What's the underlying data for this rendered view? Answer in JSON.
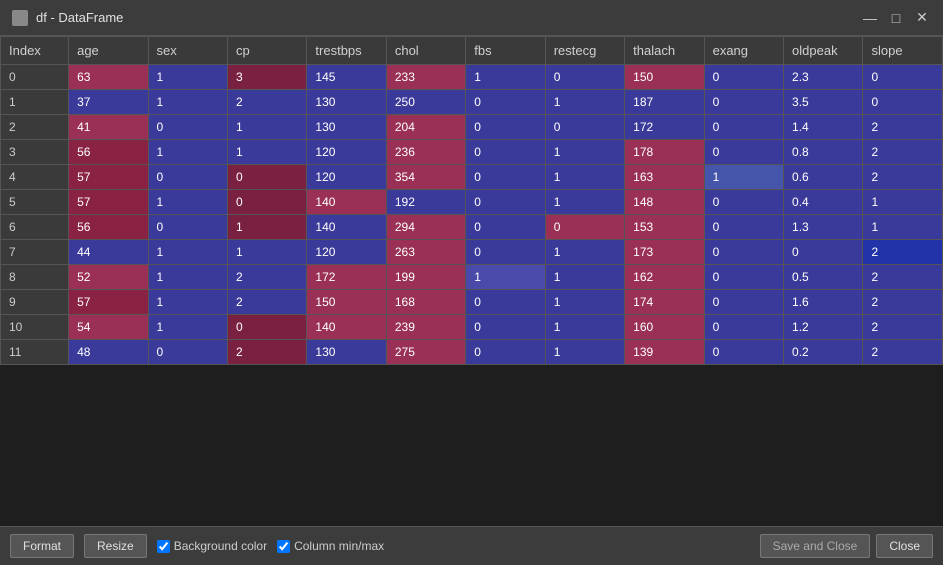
{
  "titleBar": {
    "title": "df - DataFrame",
    "minimizeIcon": "—",
    "maximizeIcon": "□",
    "closeIcon": "✕"
  },
  "table": {
    "columns": [
      "Index",
      "age",
      "sex",
      "cp",
      "trestbps",
      "chol",
      "fbs",
      "restecg",
      "thalach",
      "exang",
      "oldpeak",
      "slope"
    ],
    "rows": [
      {
        "index": "0",
        "age": "63",
        "sex": "1",
        "cp": "3",
        "trestbps": "145",
        "chol": "233",
        "fbs": "1",
        "restecg": "0",
        "thalach": "150",
        "exang": "0",
        "oldpeak": "2.3",
        "slope": "0",
        "colors": [
          "c-red",
          "c-blue",
          "c-red-dark",
          "c-blue",
          "c-red",
          "c-blue",
          "c-blue",
          "c-red",
          "c-blue",
          "c-blue",
          "c-blue",
          "c-blue"
        ]
      },
      {
        "index": "1",
        "age": "37",
        "sex": "1",
        "cp": "2",
        "trestbps": "130",
        "chol": "250",
        "fbs": "0",
        "restecg": "1",
        "thalach": "187",
        "exang": "0",
        "oldpeak": "3.5",
        "slope": "0",
        "colors": [
          "c-blue-dark",
          "c-blue",
          "c-blue",
          "c-blue",
          "c-blue",
          "c-blue",
          "c-blue",
          "c-blue",
          "c-blue",
          "c-blue",
          "c-blue",
          "c-blue"
        ]
      },
      {
        "index": "2",
        "age": "41",
        "sex": "0",
        "cp": "1",
        "trestbps": "130",
        "chol": "204",
        "fbs": "0",
        "restecg": "0",
        "thalach": "172",
        "exang": "0",
        "oldpeak": "1.4",
        "slope": "2",
        "colors": [
          "c-red",
          "c-blue",
          "c-blue",
          "c-blue",
          "c-red",
          "c-blue",
          "c-blue",
          "c-red",
          "c-blue",
          "c-blue",
          "c-blue",
          "c-purple"
        ]
      },
      {
        "index": "3",
        "age": "56",
        "sex": "1",
        "cp": "1",
        "trestbps": "120",
        "chol": "236",
        "fbs": "0",
        "restecg": "1",
        "thalach": "178",
        "exang": "0",
        "oldpeak": "0.8",
        "slope": "2",
        "colors": [
          "c-red-mid",
          "c-blue",
          "c-blue",
          "c-blue",
          "c-red",
          "c-blue",
          "c-blue",
          "c-red",
          "c-blue",
          "c-blue",
          "c-blue",
          "c-purple"
        ]
      },
      {
        "index": "4",
        "age": "57",
        "sex": "0",
        "cp": "0",
        "trestbps": "120",
        "chol": "354",
        "fbs": "0",
        "restecg": "1",
        "thalach": "163",
        "exang": "1",
        "oldpeak": "0.6",
        "slope": "2",
        "colors": [
          "c-red-mid",
          "c-blue",
          "c-red-dark",
          "c-blue",
          "c-red",
          "c-blue",
          "c-blue",
          "c-red",
          "c-mid-blue",
          "c-blue",
          "c-blue",
          "c-purple"
        ]
      },
      {
        "index": "5",
        "age": "57",
        "sex": "1",
        "cp": "0",
        "trestbps": "140",
        "chol": "192",
        "fbs": "0",
        "restecg": "1",
        "thalach": "148",
        "exang": "0",
        "oldpeak": "0.4",
        "slope": "1",
        "colors": [
          "c-red-mid",
          "c-blue",
          "c-red-dark",
          "c-red",
          "c-blue",
          "c-blue",
          "c-blue",
          "c-red",
          "c-blue",
          "c-blue",
          "c-blue",
          "c-light-purple"
        ]
      },
      {
        "index": "6",
        "age": "56",
        "sex": "0",
        "cp": "1",
        "trestbps": "140",
        "chol": "294",
        "fbs": "0",
        "restecg": "0",
        "thalach": "153",
        "exang": "0",
        "oldpeak": "1.3",
        "slope": "1",
        "colors": [
          "c-red-mid",
          "c-blue",
          "c-red-dark",
          "c-blue",
          "c-red",
          "c-blue",
          "c-red",
          "c-red",
          "c-blue",
          "c-blue",
          "c-blue",
          "c-light-purple"
        ]
      },
      {
        "index": "7",
        "age": "44",
        "sex": "1",
        "cp": "1",
        "trestbps": "120",
        "chol": "263",
        "fbs": "0",
        "restecg": "1",
        "thalach": "173",
        "exang": "0",
        "oldpeak": "0",
        "slope": "2",
        "colors": [
          "c-blue",
          "c-blue",
          "c-blue",
          "c-blue",
          "c-red",
          "c-blue",
          "c-blue",
          "c-red",
          "c-blue",
          "c-blue",
          "c-deep-blue",
          "c-purple"
        ]
      },
      {
        "index": "8",
        "age": "52",
        "sex": "1",
        "cp": "2",
        "trestbps": "172",
        "chol": "199",
        "fbs": "1",
        "restecg": "1",
        "thalach": "162",
        "exang": "0",
        "oldpeak": "0.5",
        "slope": "2",
        "colors": [
          "c-red",
          "c-blue",
          "c-blue",
          "c-red",
          "c-red",
          "c-blue-light",
          "c-blue",
          "c-red",
          "c-blue",
          "c-blue",
          "c-blue",
          "c-purple"
        ]
      },
      {
        "index": "9",
        "age": "57",
        "sex": "1",
        "cp": "2",
        "trestbps": "150",
        "chol": "168",
        "fbs": "0",
        "restecg": "1",
        "thalach": "174",
        "exang": "0",
        "oldpeak": "1.6",
        "slope": "2",
        "colors": [
          "c-red-mid",
          "c-blue",
          "c-blue",
          "c-red",
          "c-red",
          "c-blue",
          "c-blue",
          "c-red",
          "c-blue",
          "c-blue",
          "c-blue",
          "c-purple"
        ]
      },
      {
        "index": "10",
        "age": "54",
        "sex": "1",
        "cp": "0",
        "trestbps": "140",
        "chol": "239",
        "fbs": "0",
        "restecg": "1",
        "thalach": "160",
        "exang": "0",
        "oldpeak": "1.2",
        "slope": "2",
        "colors": [
          "c-red",
          "c-blue",
          "c-red-dark",
          "c-red",
          "c-red",
          "c-blue",
          "c-blue",
          "c-red",
          "c-blue",
          "c-blue",
          "c-blue",
          "c-purple"
        ]
      },
      {
        "index": "11",
        "age": "48",
        "sex": "0",
        "cp": "2",
        "trestbps": "130",
        "chol": "275",
        "fbs": "0",
        "restecg": "1",
        "thalach": "139",
        "exang": "0",
        "oldpeak": "0.2",
        "slope": "2",
        "colors": [
          "c-blue",
          "c-blue",
          "c-red-dark",
          "c-blue",
          "c-red",
          "c-blue",
          "c-blue",
          "c-red",
          "c-blue",
          "c-blue",
          "c-blue",
          "c-purple"
        ]
      }
    ]
  },
  "bottomBar": {
    "formatLabel": "Format",
    "resizeLabel": "Resize",
    "bgColorLabel": "Background color",
    "colMinMaxLabel": "Column min/max",
    "saveCloseLabel": "Save and Close",
    "closeLabel": "Close",
    "bgColorChecked": true,
    "colMinMaxChecked": true
  }
}
